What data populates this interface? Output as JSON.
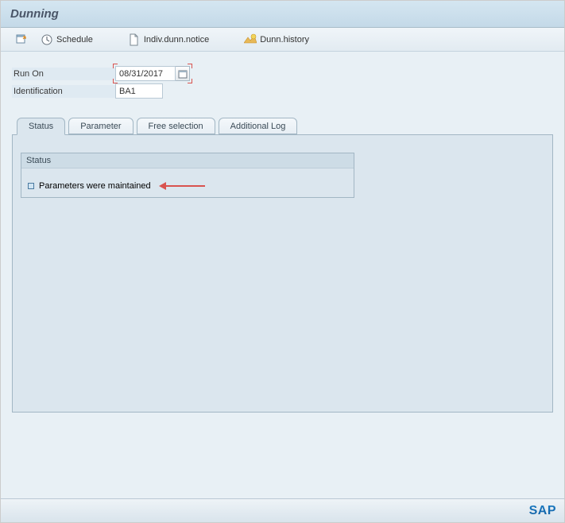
{
  "header": {
    "title": "Dunning"
  },
  "toolbar": {
    "schedule_label": "Schedule",
    "indiv_label": "Indiv.dunn.notice",
    "history_label": "Dunn.history"
  },
  "form": {
    "run_on_label": "Run On",
    "run_on_value": "08/31/2017",
    "identification_label": "Identification",
    "identification_value": "BA1"
  },
  "tabs": {
    "status": "Status",
    "parameter": "Parameter",
    "free_selection": "Free selection",
    "additional_log": "Additional Log"
  },
  "status_panel": {
    "group_title": "Status",
    "message": "Parameters were maintained"
  },
  "footer": {
    "brand": "SAP"
  }
}
